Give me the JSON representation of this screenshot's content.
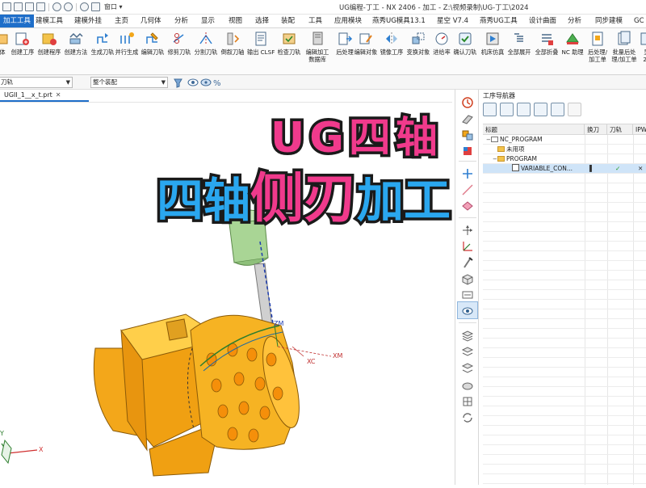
{
  "window": {
    "title": "UG编程-丁工 - NX 2406 - 加工 - Z:\\视频录制\\UG-丁工\\2024",
    "menu": "窗口 ▾",
    "quick_access_icons": [
      "menu-icon",
      "new-file-icon",
      "open-file-icon",
      "save-icon",
      "undo-icon",
      "redo-icon",
      "mic-icon",
      "sketch-icon"
    ]
  },
  "tabs": [
    {
      "label": "加工工具",
      "active": true
    },
    {
      "label": "建模工具"
    },
    {
      "label": "建模外挂"
    },
    {
      "label": "主页"
    },
    {
      "label": "几何体"
    },
    {
      "label": "分析"
    },
    {
      "label": "显示"
    },
    {
      "label": "视图"
    },
    {
      "label": "选择"
    },
    {
      "label": "装配"
    },
    {
      "label": "工具"
    },
    {
      "label": "应用模块"
    },
    {
      "label": "燕秀UG模具13.1"
    },
    {
      "label": "星空 V7.4"
    },
    {
      "label": "燕秀UG工具"
    },
    {
      "label": "设计曲面"
    },
    {
      "label": "分析"
    },
    {
      "label": "同步建模"
    },
    {
      "label": "GC"
    }
  ],
  "ribbon": [
    {
      "label": "体",
      "icon": "body-icon"
    },
    {
      "label": "创建工序",
      "icon": "create-operation-icon"
    },
    {
      "label": "创建程序",
      "icon": "create-program-icon"
    },
    {
      "label": "创建方法",
      "icon": "create-method-icon"
    },
    {
      "label": "生成刀轨",
      "icon": "generate-toolpath-icon"
    },
    {
      "label": "并行生成",
      "icon": "parallel-generate-icon"
    },
    {
      "label": "编辑刀轨",
      "icon": "edit-toolpath-icon"
    },
    {
      "label": "修剪刀轨",
      "icon": "trim-toolpath-icon"
    },
    {
      "label": "分割刀轨",
      "icon": "split-toolpath-icon"
    },
    {
      "label": "倒叙刀轴",
      "icon": "reverse-axis-icon"
    },
    {
      "label": "输出 CLSF",
      "icon": "output-clsf-icon"
    },
    {
      "label": "检查刀轨",
      "icon": "verify-toolpath-icon"
    },
    {
      "label": "编辑加工",
      "label2": "数据库",
      "icon": "machining-database-icon"
    },
    {
      "label": "后处理",
      "icon": "postprocess-icon"
    },
    {
      "label": "编辑对象",
      "icon": "edit-object-icon"
    },
    {
      "label": "镜像工序",
      "icon": "mirror-operation-icon"
    },
    {
      "label": "变换对象",
      "icon": "transform-object-icon"
    },
    {
      "label": "进给率",
      "icon": "feedrate-icon"
    },
    {
      "label": "确认刀轨",
      "icon": "confirm-toolpath-icon"
    },
    {
      "label": "机床仿真",
      "icon": "machine-simulation-icon"
    },
    {
      "label": "全部展开",
      "icon": "expand-all-icon"
    },
    {
      "label": "全部折叠",
      "icon": "collapse-all-icon"
    },
    {
      "label": "NC 助理",
      "icon": "nc-assistant-icon"
    },
    {
      "label": "后处理/",
      "label2": "加工单",
      "icon": "post-sheet-icon"
    },
    {
      "label": "批量后处",
      "label2": "理/加工单",
      "icon": "batch-post-icon"
    },
    {
      "label": "显",
      "label2": "20",
      "icon": "display-icon"
    }
  ],
  "selection_bar": {
    "filter_value": "刀轨",
    "scope_value": "整个装配"
  },
  "file_tab": {
    "label": "UGII_1__x_t.prt"
  },
  "navigator": {
    "title": "工序导航器",
    "columns": [
      "标题",
      "换刀",
      "刀轨",
      "IPW"
    ],
    "rows": [
      {
        "indent": 0,
        "expander": "−",
        "icon": "program-group-icon",
        "name": "NC_PROGRAM"
      },
      {
        "indent": 1,
        "expander": "",
        "icon": "folder-icon",
        "name": "未用项"
      },
      {
        "indent": 1,
        "expander": "−",
        "icon": "folder-icon",
        "name": "PROGRAM"
      },
      {
        "indent": 2,
        "expander": "",
        "icon": "operation-icon",
        "name": "VARIABLE_CON...",
        "selected": true,
        "tool_change": "▌",
        "toolpath": "✓",
        "ipw": "✕"
      }
    ]
  },
  "overlay": {
    "line1": "UG四轴",
    "line2_a": "四轴",
    "line2_b": "侧刃",
    "line2_c": "加工"
  },
  "viewport_labels": {
    "zm": "ZM",
    "xc": "XC",
    "xm": "XM",
    "y": "Y",
    "x": "X"
  },
  "colors": {
    "accent": "#1e6ec9",
    "part": "#f3a71a",
    "tool": "#9fcf8a",
    "overlay_pink": "#f03a8c",
    "overlay_blue": "#2aa7ef"
  }
}
